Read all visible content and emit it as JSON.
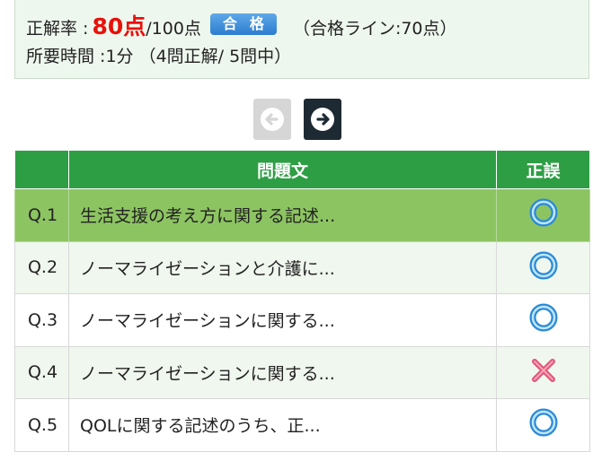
{
  "summary": {
    "rate_label": "正解率 :",
    "score": "80点",
    "full": "/100点",
    "badge": "合格",
    "pass_line": "（合格ライン:70点）",
    "time_line": "所要時間 :1分 （4問正解/ 5問中）"
  },
  "nav": {
    "prev_icon": "arrow-left-circle-icon",
    "next_icon": "arrow-right-circle-icon"
  },
  "table": {
    "headers": [
      "",
      "問題文",
      "正誤"
    ],
    "rows": [
      {
        "num": "Q.1",
        "text": "生活支援の考え方に関する記述...",
        "result": "correct"
      },
      {
        "num": "Q.2",
        "text": "ノーマライゼーションと介護に...",
        "result": "correct"
      },
      {
        "num": "Q.3",
        "text": "ノーマライゼーションに関する...",
        "result": "correct"
      },
      {
        "num": "Q.4",
        "text": "ノーマライゼーションに関する...",
        "result": "incorrect"
      },
      {
        "num": "Q.5",
        "text": "QOLに関する記述のうち、正...",
        "result": "correct"
      }
    ]
  },
  "colors": {
    "header_green": "#2e9e44",
    "selected_row": "#8dc462",
    "score_red": "#e8120b",
    "badge_blue": "#2d7dd0",
    "correct_blue": "#2b8ad6",
    "incorrect_red": "#e0557a"
  }
}
